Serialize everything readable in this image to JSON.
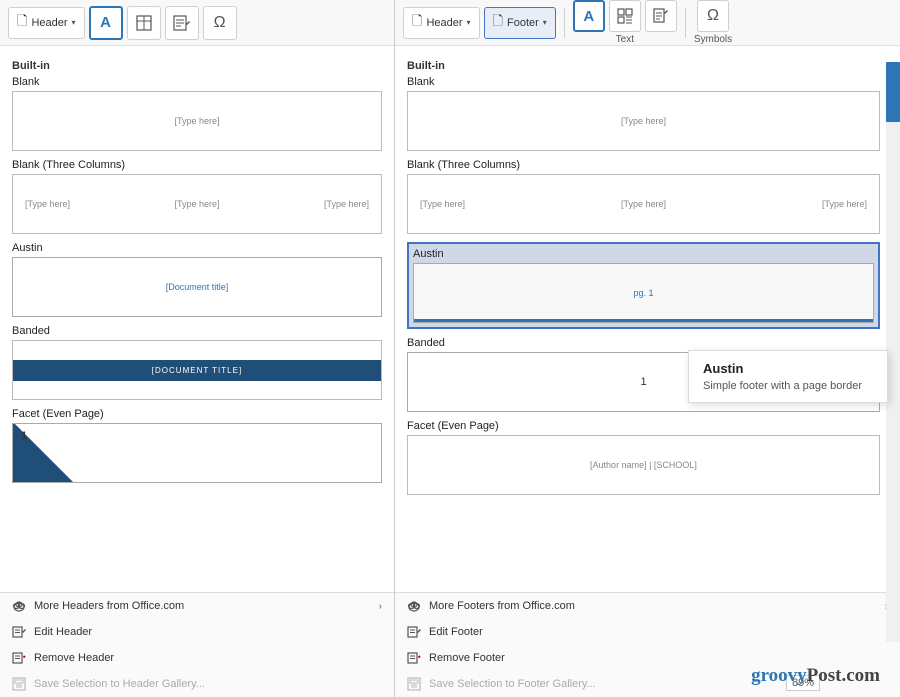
{
  "left": {
    "toolbar": {
      "header_btn": "Header",
      "dropdown": "▾",
      "icons": [
        "A",
        "📋",
        "✏",
        "Ω"
      ]
    },
    "section": "Built-in",
    "templates": [
      {
        "name": "Blank",
        "type": "blank",
        "placeholder": "[Type here]"
      },
      {
        "name": "Blank (Three Columns)",
        "type": "three-col",
        "placeholders": [
          "[Type here]",
          "[Type here]",
          "[Type here]"
        ]
      },
      {
        "name": "Austin",
        "type": "austin-header",
        "placeholder": "[Document title]"
      },
      {
        "name": "Banded",
        "type": "banded",
        "placeholder": "[DOCUMENT TITLE]"
      },
      {
        "name": "Facet (Even Page)",
        "type": "facet",
        "num": "1"
      }
    ],
    "footer_links": [
      {
        "label": "More Headers from Office.com",
        "has_arrow": true,
        "disabled": false
      },
      {
        "label": "Edit Header",
        "disabled": false
      },
      {
        "label": "Remove Header",
        "disabled": false
      },
      {
        "label": "Save Selection to Header Gallery...",
        "disabled": true
      }
    ]
  },
  "right": {
    "toolbar": {
      "header_btn": "Header",
      "footer_btn": "Footer",
      "text_label": "Text",
      "symbols_label": "Symbols",
      "icons": [
        "A",
        "📋✓",
        "✏",
        "Ω"
      ]
    },
    "section": "Built-in",
    "templates": [
      {
        "name": "Blank",
        "type": "blank",
        "placeholder": "[Type here]"
      },
      {
        "name": "Blank (Three Columns)",
        "type": "three-col",
        "placeholders": [
          "[Type here]",
          "[Type here]",
          "[Type here]"
        ]
      },
      {
        "name": "Austin",
        "type": "austin-footer",
        "num": "pg. 1",
        "selected": true
      },
      {
        "name": "Banded",
        "type": "banded-footer",
        "num": "1"
      },
      {
        "name": "Facet (Even Page)",
        "type": "facet-footer",
        "placeholder": "[Author name] | [SCHOOL]"
      }
    ],
    "tooltip": {
      "title": "Austin",
      "description": "Simple footer with a page border"
    },
    "footer_links": [
      {
        "label": "More Footers from Office.com",
        "has_arrow": true,
        "disabled": false
      },
      {
        "label": "Edit Footer",
        "disabled": false
      },
      {
        "label": "Remove Footer",
        "disabled": false
      },
      {
        "label": "Save Selection to Footer Gallery...",
        "disabled": true
      }
    ],
    "zoom": "89%"
  }
}
